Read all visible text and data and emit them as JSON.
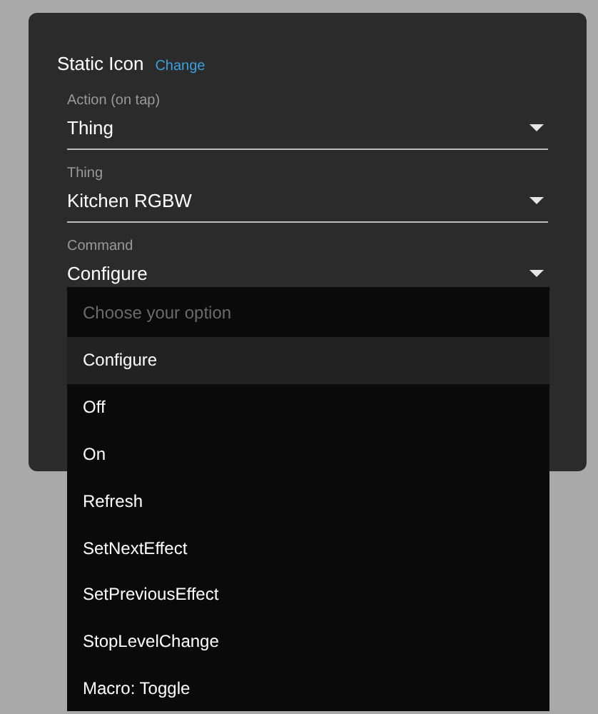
{
  "dialog": {
    "title": "Static Icon",
    "change_link": "Change",
    "fields": [
      {
        "label": "Action (on tap)",
        "value": "Thing"
      },
      {
        "label": "Thing",
        "value": "Kitchen RGBW"
      },
      {
        "label": "Command",
        "value": "Configure"
      }
    ]
  },
  "dropdown": {
    "placeholder": "Choose your option",
    "options": [
      {
        "label": "Configure",
        "selected": true
      },
      {
        "label": "Off",
        "selected": false
      },
      {
        "label": "On",
        "selected": false
      },
      {
        "label": "Refresh",
        "selected": false
      },
      {
        "label": "SetNextEffect",
        "selected": false
      },
      {
        "label": "SetPreviousEffect",
        "selected": false
      },
      {
        "label": "StopLevelChange",
        "selected": false
      },
      {
        "label": "Macro: Toggle",
        "selected": false
      }
    ]
  }
}
